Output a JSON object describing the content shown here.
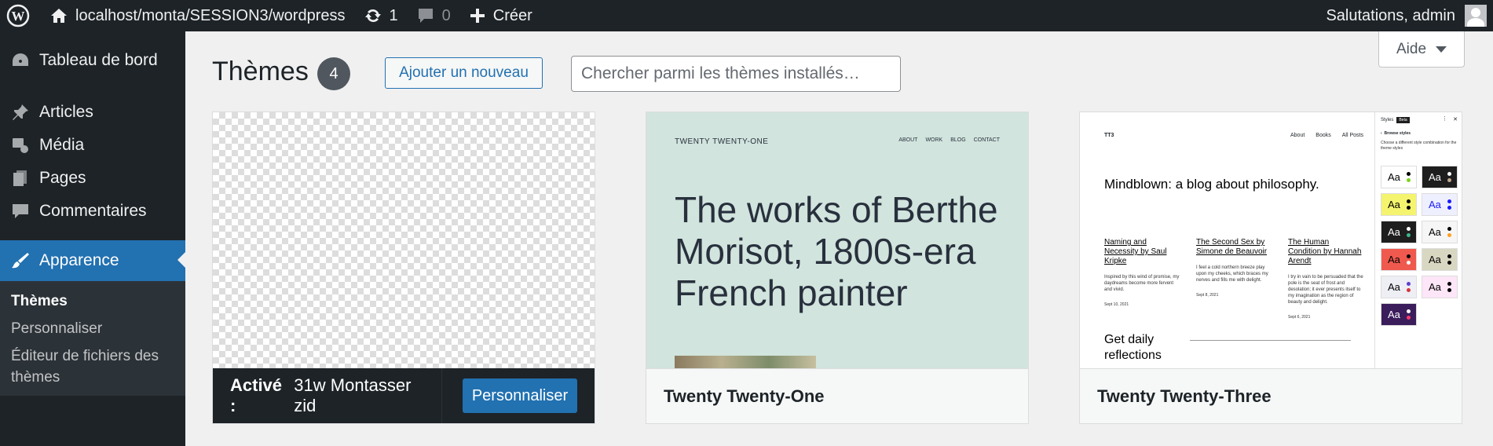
{
  "admin_bar": {
    "site_name": "localhost/monta/SESSION3/wordpress",
    "updates_count": "1",
    "comments_count": "0",
    "new_label": "Créer",
    "greeting": "Salutations, admin"
  },
  "sidebar": {
    "items": [
      {
        "label": "Tableau de bord",
        "icon": "dashboard-icon"
      },
      {
        "label": "Articles",
        "icon": "pin-icon"
      },
      {
        "label": "Média",
        "icon": "media-icon"
      },
      {
        "label": "Pages",
        "icon": "pages-icon"
      },
      {
        "label": "Commentaires",
        "icon": "comment-icon"
      },
      {
        "label": "Apparence",
        "icon": "paintbrush-icon"
      }
    ],
    "submenu": [
      "Thèmes",
      "Personnaliser",
      "Éditeur de fichiers des thèmes"
    ]
  },
  "page": {
    "title": "Thèmes",
    "count": "4",
    "add_new_label": "Ajouter un nouveau",
    "search_placeholder": "Chercher parmi les thèmes installés…",
    "help_label": "Aide"
  },
  "themes": [
    {
      "name": "31w Montasser zid",
      "active_label": "Activé :",
      "customize_label": "Personnaliser"
    },
    {
      "name": "Twenty Twenty-One",
      "preview": {
        "site_title": "TWENTY TWENTY-ONE",
        "nav": [
          "ABOUT",
          "WORK",
          "BLOG",
          "CONTACT"
        ],
        "hero": "The works of Berthe Morisot, 1800s-era French painter"
      }
    },
    {
      "name": "Twenty Twenty-Three",
      "preview": {
        "brand": "TT3",
        "nav": [
          "About",
          "Books",
          "All Posts"
        ],
        "headline": "Mindblown: a blog about philosophy.",
        "posts": [
          {
            "title": "Naming and Necessity by Saul Kripke",
            "excerpt": "Inspired by this wind of promise, my daydreams become more fervent and vivid.",
            "date": "Sept 10, 2021"
          },
          {
            "title": "The Second Sex by Simone de Beauvoir",
            "excerpt": "I feel a cold northern breeze play upon my cheeks, which braces my nerves and fills me with delight.",
            "date": "Sept 8, 2021"
          },
          {
            "title": "The Human Condition by Hannah Arendt",
            "excerpt": "I try in vain to be persuaded that the pole is the seat of frost and desolation; it ever presents itself to my imagination as the region of beauty and delight.",
            "date": "Sept 6, 2021"
          }
        ],
        "daily": "Get daily reflections",
        "panel": {
          "title": "Styles",
          "badge": "Beta",
          "browse": "Browse styles",
          "description": "Choose a different style combination for the theme styles",
          "swatch_label": "Aa",
          "swatches": [
            {
              "bg": "#ffffff",
              "fg": "#000000",
              "dots": [
                "#000000",
                "#7ed321"
              ]
            },
            {
              "bg": "#1e1e1e",
              "fg": "#ffffff",
              "dots": [
                "#ffffff",
                "#c2a990"
              ]
            },
            {
              "bg": "#f5f46f",
              "fg": "#000000",
              "dots": [
                "#000000",
                "#000000"
              ]
            },
            {
              "bg": "#eef0ff",
              "fg": "#1a1aff",
              "dots": [
                "#1a1aff",
                "#1a1aff"
              ]
            },
            {
              "bg": "#1e1e1e",
              "fg": "#ffffff",
              "dots": [
                "#ffffff",
                "#3fb58a"
              ]
            },
            {
              "bg": "#f6f6f6",
              "fg": "#000000",
              "dots": [
                "#000000",
                "#ff9f1c"
              ]
            },
            {
              "bg": "#f0594e",
              "fg": "#000000",
              "dots": [
                "#000000",
                "#ffffff"
              ]
            },
            {
              "bg": "#d8d7c2",
              "fg": "#000000",
              "dots": [
                "#000000",
                "#000000"
              ]
            },
            {
              "bg": "#eeeef5",
              "fg": "#000000",
              "dots": [
                "#5d3fd3",
                "#d63638"
              ]
            },
            {
              "bg": "#fce6f7",
              "fg": "#000000",
              "dots": [
                "#000000",
                "#000000"
              ]
            },
            {
              "bg": "#3b1d5c",
              "fg": "#ffffff",
              "dots": [
                "#ffffff",
                "#ff3b6e"
              ]
            }
          ]
        }
      }
    }
  ]
}
